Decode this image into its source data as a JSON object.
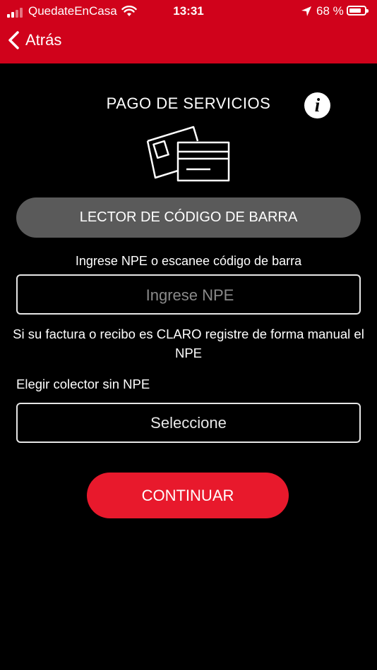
{
  "status_bar": {
    "carrier": "QuedateEnCasa",
    "time": "13:31",
    "battery": "68 %"
  },
  "nav": {
    "back_label": "Atrás"
  },
  "page": {
    "title": "PAGO DE SERVICIOS",
    "info_glyph": "i",
    "scan_button": "LECTOR DE CÓDIGO DE BARRA",
    "npe_label": "Ingrese NPE o escanee código de barra",
    "npe_placeholder": "Ingrese NPE",
    "note": "Si su factura o recibo es CLARO registre de forma manual el NPE",
    "collector_label": "Elegir colector sin NPE",
    "collector_select": "Seleccione",
    "continue_button": "CONTINUAR"
  },
  "colors": {
    "brand_red": "#d0021b",
    "button_red": "#e8192c",
    "scan_gray": "#5a5a5a"
  },
  "icons": [
    "signal-icon",
    "wifi-icon",
    "location-arrow-icon",
    "battery-icon",
    "chevron-left-icon",
    "info-icon",
    "cards-icon"
  ]
}
